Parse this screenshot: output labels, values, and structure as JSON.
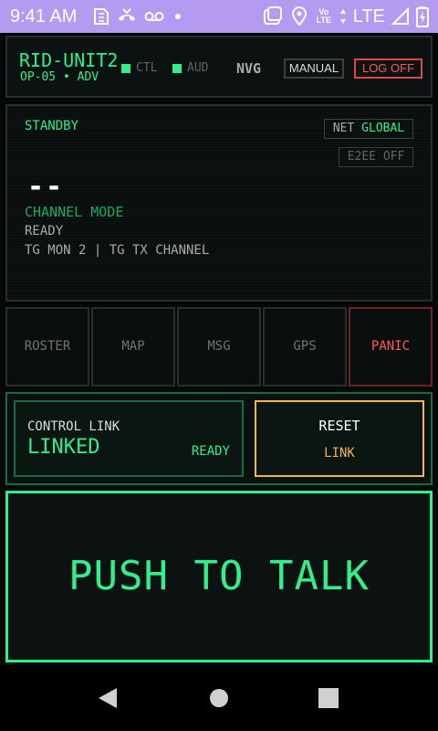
{
  "status_bar": {
    "time": "9:41 AM",
    "volte_top": "Vo",
    "volte_bottom": "LTE",
    "network": "LTE",
    "icons": [
      "sim-icon",
      "call-end-icon",
      "voicemail-icon",
      "notification-dot-icon",
      "cast-icon",
      "location-icon",
      "volte-icon",
      "signal-icon",
      "battery-charging-icon"
    ]
  },
  "header": {
    "unit_name": "RID-UNIT2",
    "unit_sub": "OP-05 • ADV",
    "indicators": [
      {
        "label": "CTL",
        "color": "#2ff08a"
      },
      {
        "label": "AUD",
        "color": "#2ff08a"
      }
    ],
    "nvg_label": "NVG",
    "manual_label": "MANUAL",
    "logoff_label": "LOG OFF"
  },
  "display": {
    "state": "STANDBY",
    "net_prefix": "NET",
    "net_value": "GLOBAL",
    "e2ee": "E2EE OFF",
    "placeholder": "--",
    "channel_mode": "CHANNEL MODE",
    "ready": "READY",
    "talkgroups": "TG MON 2 | TG TX CHANNEL"
  },
  "function_keys": [
    {
      "label": "ROSTER"
    },
    {
      "label": "MAP"
    },
    {
      "label": "MSG"
    },
    {
      "label": "GPS"
    },
    {
      "label": "PANIC",
      "color": "#ff5960"
    }
  ],
  "link": {
    "control_label": "CONTROL LINK",
    "control_state": "LINKED",
    "control_status": "READY",
    "reset_label": "RESET",
    "reset_sub": "LINK"
  },
  "ptt": {
    "label": "PUSH TO TALK"
  },
  "colors": {
    "accent": "#2ff08a",
    "danger": "#ff5960",
    "warning": "#f0b650",
    "background": "#050807"
  },
  "nav_bar": {
    "icons": [
      "back-icon",
      "home-icon",
      "recents-icon"
    ]
  }
}
